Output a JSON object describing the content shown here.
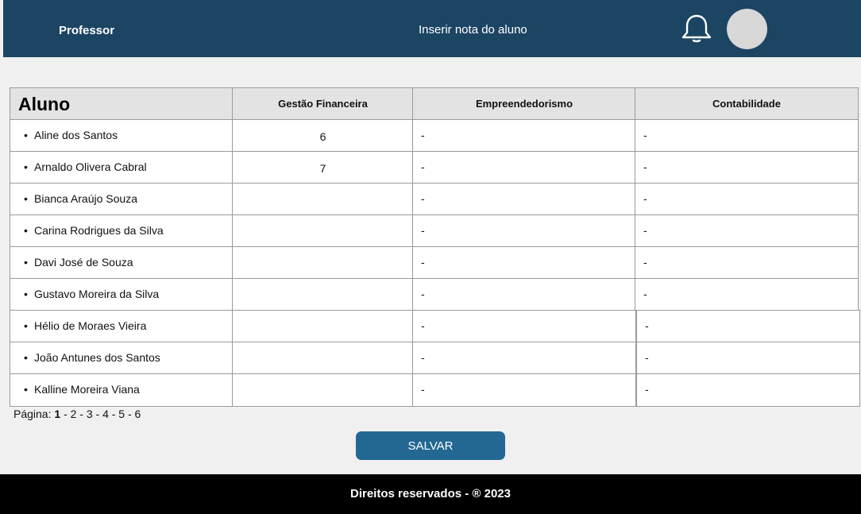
{
  "header": {
    "role": "Professor",
    "title": "Inserir nota do aluno"
  },
  "table": {
    "headers": [
      "Aluno",
      "Gestão Financeira",
      "Empreendedorismo",
      "Contabilidade"
    ],
    "rows": [
      {
        "name": "Aline dos Santos",
        "gestao": "6",
        "empreendedorismo": "-",
        "contabilidade": "-"
      },
      {
        "name": "Arnaldo Olivera Cabral",
        "gestao": "7",
        "empreendedorismo": "-",
        "contabilidade": "-"
      },
      {
        "name": "Bianca Araújo Souza",
        "gestao": "",
        "empreendedorismo": "-",
        "contabilidade": "-"
      },
      {
        "name": "Carina Rodrigues da Silva",
        "gestao": "",
        "empreendedorismo": "-",
        "contabilidade": "-"
      },
      {
        "name": "Davi José de Souza",
        "gestao": "",
        "empreendedorismo": "-",
        "contabilidade": "-"
      },
      {
        "name": "Gustavo Moreira da Silva",
        "gestao": "",
        "empreendedorismo": "-",
        "contabilidade": "-"
      },
      {
        "name": "Hélio de Moraes Vieira",
        "gestao": "",
        "empreendedorismo": "-",
        "contabilidade": "-"
      },
      {
        "name": "João Antunes dos Santos",
        "gestao": "",
        "empreendedorismo": "-",
        "contabilidade": "-"
      },
      {
        "name": "Kalline Moreira Viana",
        "gestao": "",
        "empreendedorismo": "-",
        "contabilidade": "-"
      }
    ]
  },
  "pagination": {
    "label": "Página:",
    "current": "1",
    "others": "-  2 - 3 - 4 - 5 - 6"
  },
  "save_label": "SALVAR",
  "footer": {
    "text": "Direitos reservados - ® 2023"
  },
  "icons": {
    "bell": "bell-icon",
    "avatar": "avatar"
  },
  "colors": {
    "header": "#1c4564",
    "button": "#236893",
    "footer": "#000000"
  }
}
